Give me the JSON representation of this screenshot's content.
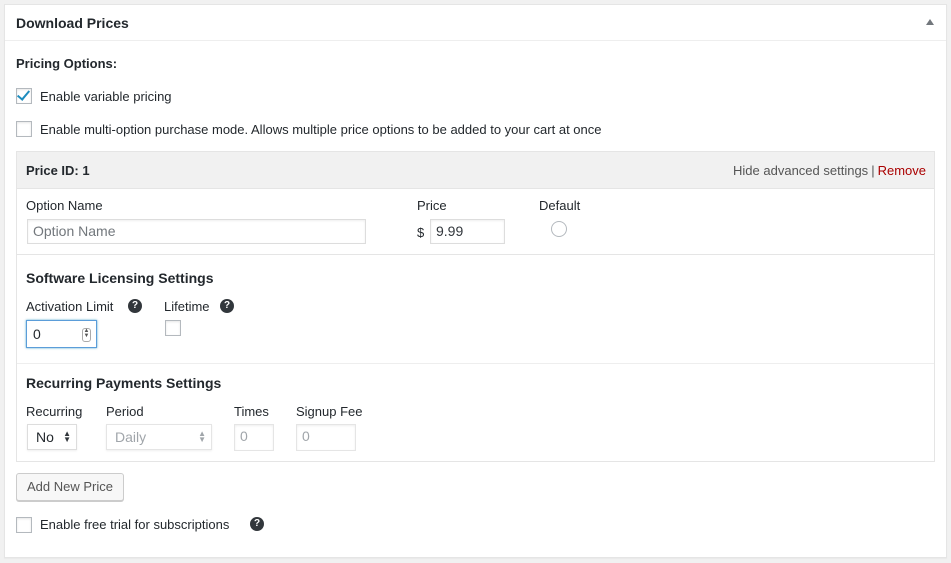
{
  "panel": {
    "title": "Download Prices"
  },
  "pricing": {
    "label": "Pricing Options:",
    "variable_pricing": {
      "label": "Enable variable pricing",
      "checked": true
    },
    "multi_option": {
      "label": "Enable multi-option purchase mode. Allows multiple price options to be added to your cart at once",
      "checked": false
    }
  },
  "price_row": {
    "id_label": "Price ID: 1",
    "hide_advanced": "Hide advanced settings",
    "separator": "|",
    "remove": "Remove",
    "option_name_label": "Option Name",
    "option_name_placeholder": "Option Name",
    "price_label": "Price",
    "currency": "$",
    "price_value": "9.99",
    "default_label": "Default"
  },
  "licensing": {
    "title": "Software Licensing Settings",
    "activation_limit_label": "Activation Limit",
    "activation_limit_value": "0",
    "lifetime_label": "Lifetime",
    "help": "?"
  },
  "recurring": {
    "title": "Recurring Payments Settings",
    "recurring_label": "Recurring",
    "recurring_value": "No",
    "period_label": "Period",
    "period_value": "Daily",
    "times_label": "Times",
    "times_value": "0",
    "signup_fee_label": "Signup Fee",
    "signup_fee_value": "0"
  },
  "actions": {
    "add_new_price": "Add New Price"
  },
  "free_trial": {
    "label": "Enable free trial for subscriptions",
    "checked": false,
    "help": "?"
  },
  "colors": {
    "accent": "#1e8cbe",
    "remove": "#aa0000",
    "border": "#e5e5e5"
  }
}
